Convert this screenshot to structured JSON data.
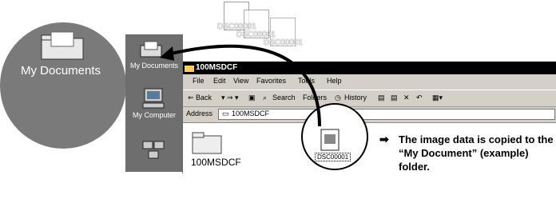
{
  "zoom": {
    "label": "My Documents",
    "icon": "folder-icon"
  },
  "desktop": {
    "items": [
      {
        "label": "My Documents",
        "icon": "my-documents-icon"
      },
      {
        "label": "My Computer",
        "icon": "my-computer-icon"
      },
      {
        "label": "",
        "icon": "network-icon"
      }
    ]
  },
  "flying_files": [
    "DSC00001",
    "DSC00001",
    "DSC00001"
  ],
  "window": {
    "title": "100MSDCF",
    "menu": [
      "File",
      "Edit",
      "View",
      "Favorites",
      "Tools",
      "Help"
    ],
    "toolbar": {
      "back": "Back",
      "search": "Search",
      "folders": "Folders",
      "history": "History"
    },
    "address_label": "Address",
    "address_value": "100MSDCF",
    "folder_name": "100MSDCF"
  },
  "file": {
    "label": "DSC00001"
  },
  "callout": "The image data is copied to the “My Document” (example) folder."
}
